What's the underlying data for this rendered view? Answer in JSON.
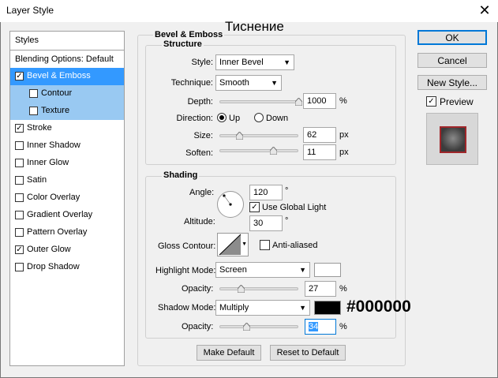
{
  "window": {
    "title": "Layer Style",
    "close_glyph": "✕"
  },
  "overlay": {
    "title_ru": "Тиснение",
    "shadow_color_hex_label": "#000000"
  },
  "left_panel": {
    "styles_label": "Styles",
    "blending_label": "Blending Options: Default",
    "items": [
      {
        "label": "Bevel & Emboss",
        "checked": "✓",
        "state": "selected"
      },
      {
        "label": "Contour",
        "checked": "",
        "state": "sub"
      },
      {
        "label": "Texture",
        "checked": "",
        "state": "sub"
      },
      {
        "label": "Stroke",
        "checked": "✓",
        "state": ""
      },
      {
        "label": "Inner Shadow",
        "checked": "",
        "state": ""
      },
      {
        "label": "Inner Glow",
        "checked": "",
        "state": ""
      },
      {
        "label": "Satin",
        "checked": "",
        "state": ""
      },
      {
        "label": "Color Overlay",
        "checked": "",
        "state": ""
      },
      {
        "label": "Gradient Overlay",
        "checked": "",
        "state": ""
      },
      {
        "label": "Pattern Overlay",
        "checked": "",
        "state": ""
      },
      {
        "label": "Outer Glow",
        "checked": "✓",
        "state": ""
      },
      {
        "label": "Drop Shadow",
        "checked": "",
        "state": ""
      }
    ]
  },
  "bevel": {
    "group_title": "Bevel & Emboss",
    "structure_title": "Structure",
    "style_label": "Style:",
    "style_value": "Inner Bevel",
    "technique_label": "Technique:",
    "technique_value": "Smooth",
    "depth_label": "Depth:",
    "depth_value": "1000",
    "depth_level": 1.0,
    "percent": "%",
    "direction_label": "Direction:",
    "direction_up": "Up",
    "direction_down": "Down",
    "size_label": "Size:",
    "size_value": "62",
    "size_level": 0.25,
    "px": "px",
    "soften_label": "Soften:",
    "soften_value": "11",
    "soften_level": 0.68
  },
  "shading": {
    "title": "Shading",
    "angle_label": "Angle:",
    "angle_value": "120",
    "degree": "°",
    "use_global_light_label": "Use Global Light",
    "use_global_light_checked": "✓",
    "altitude_label": "Altitude:",
    "altitude_value": "30",
    "gloss_contour_label": "Gloss Contour:",
    "anti_aliased_label": "Anti-aliased",
    "anti_aliased_checked": "",
    "highlight_mode_label": "Highlight Mode:",
    "highlight_mode_value": "Screen",
    "highlight_color": "#ffffff",
    "highlight_opacity_label": "Opacity:",
    "highlight_opacity_value": "27",
    "highlight_opacity_level": 0.27,
    "shadow_mode_label": "Shadow Mode:",
    "shadow_mode_value": "Multiply",
    "shadow_color": "#000000",
    "shadow_opacity_label": "Opacity:",
    "shadow_opacity_value": "34",
    "shadow_opacity_level": 0.34,
    "percent": "%"
  },
  "footer": {
    "make_default_label": "Make Default",
    "reset_default_label": "Reset to Default"
  },
  "right": {
    "ok_label": "OK",
    "cancel_label": "Cancel",
    "new_style_label": "New Style...",
    "preview_label": "Preview",
    "preview_checked": "✓"
  }
}
